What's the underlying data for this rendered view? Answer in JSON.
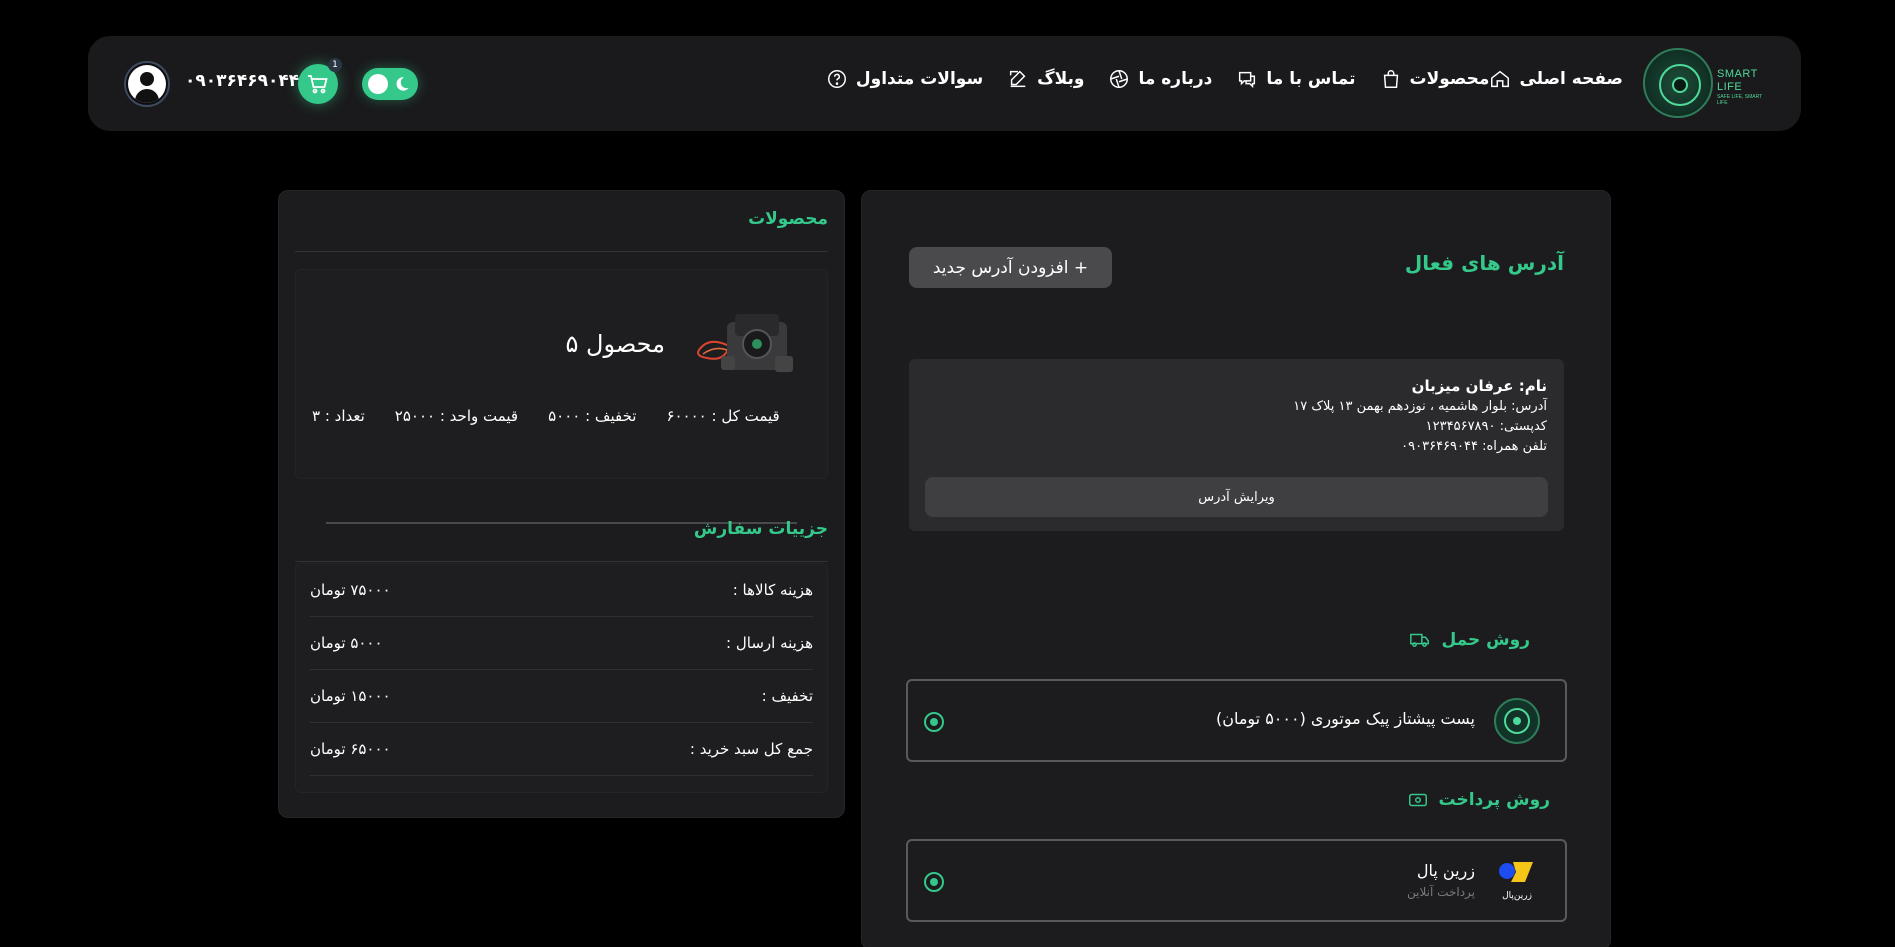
{
  "header": {
    "logo": {
      "line1": "SMART",
      "line2": "LIFE",
      "tagline": "SAFE LIFE, SMART LIFE"
    },
    "nav": [
      {
        "label": "صفحه اصلی",
        "icon": "home-icon"
      },
      {
        "label": "محصولات",
        "icon": "shopping-bag-icon"
      },
      {
        "label": "تماس با ما",
        "icon": "chat-icon"
      },
      {
        "label": "درباره ما",
        "icon": "aperture-icon"
      },
      {
        "label": "وبلاگ",
        "icon": "edit-icon"
      },
      {
        "label": "سوالات متداول",
        "icon": "question-icon"
      }
    ],
    "cart_count": "1",
    "phone": "۰۹۰۳۶۴۶۹۰۴۴"
  },
  "products": {
    "title": "محصولات",
    "item": {
      "name": "محصول ۵",
      "quantity": "تعداد : ۳",
      "unit_price": "قیمت واحد : ۲۵۰۰۰",
      "discount": "تخفیف : ۵۰۰۰",
      "total_price": "قیمت کل : ۶۰۰۰۰"
    }
  },
  "order_details": {
    "title": "جزییات سفارش",
    "rows": [
      {
        "label": "هزینه کالاها :",
        "value": "۷۵۰۰۰ تومان"
      },
      {
        "label": "هزینه ارسال :",
        "value": "۵۰۰۰ تومان"
      },
      {
        "label": "تخفیف :",
        "value": "۱۵۰۰۰ تومان"
      },
      {
        "label": "جمع کل سبد خرید :",
        "value": "۶۵۰۰۰ تومان"
      }
    ]
  },
  "addresses": {
    "title": "آدرس های فعال",
    "add_button": "+ افزودن آدرس جدید",
    "card": {
      "name": "نام: عرفان میزبان",
      "address": "آدرس: بلوار هاشمیه ، نوزدهم بهمن ۱۳ پلاک ۱۷",
      "postal": "کدپستی: ۱۲۳۴۵۶۷۸۹۰",
      "mobile": "تلفن همراه: ۰۹۰۳۶۴۶۹۰۴۴",
      "edit_button": "ویرایش آدرس"
    }
  },
  "shipping": {
    "title": "روش حمل",
    "option": "پست پیشتاز پیک موتوری (۵۰۰۰ تومان)"
  },
  "payment": {
    "title": "روش پرداخت",
    "option": "زرین پال",
    "option_sub": "پرداخت آنلاین",
    "logo_text": "زرین‌پال"
  },
  "colors": {
    "accent": "#34c88a",
    "panel": "#1c1c1e",
    "background": "#000000"
  }
}
